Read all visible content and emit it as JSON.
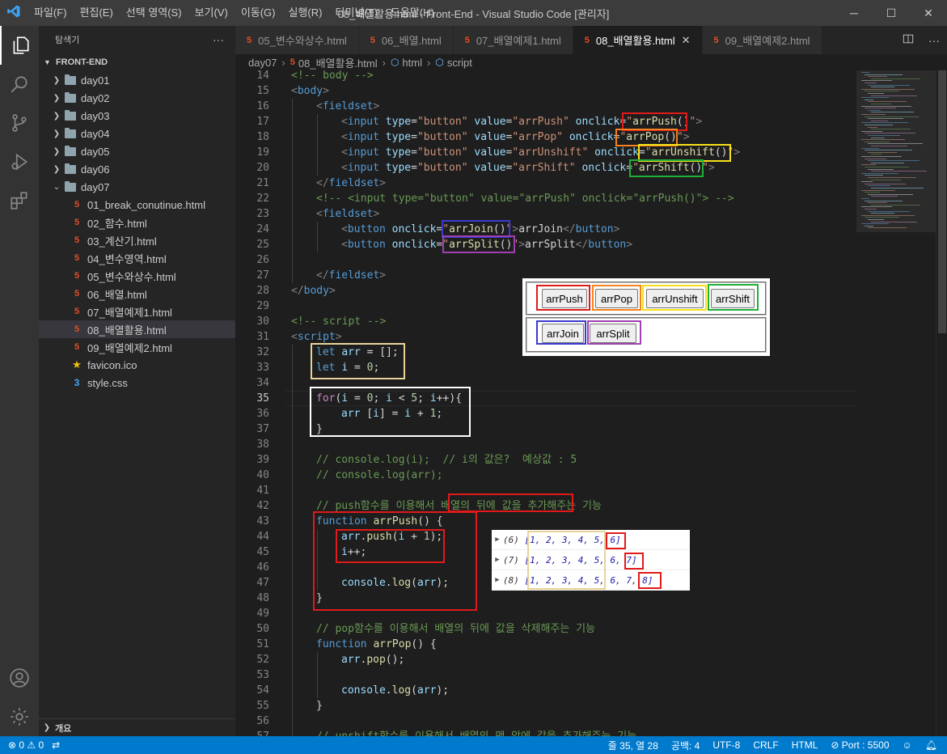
{
  "window": {
    "title": "08_배열활용.html - Front-End - Visual Studio Code [관리자]",
    "menu": [
      "파일(F)",
      "편집(E)",
      "선택 영역(S)",
      "보기(V)",
      "이동(G)",
      "실행(R)",
      "터미널(T)",
      "도움말(H)"
    ],
    "controls": [
      "─",
      "☐",
      "✕"
    ]
  },
  "activity_bar": {
    "items": [
      "explorer-icon",
      "search-icon",
      "source-control-icon",
      "run-debug-icon",
      "extensions-icon"
    ],
    "bottom": [
      "account-icon",
      "settings-gear-icon"
    ]
  },
  "sidebar": {
    "header": "탐색기",
    "more": "···",
    "section": "FRONT-END",
    "folders": [
      {
        "name": "day01",
        "open": false
      },
      {
        "name": "day02",
        "open": false
      },
      {
        "name": "day03",
        "open": false
      },
      {
        "name": "day04",
        "open": false
      },
      {
        "name": "day05",
        "open": false
      },
      {
        "name": "day06",
        "open": false
      },
      {
        "name": "day07",
        "open": true
      }
    ],
    "files": [
      {
        "name": "01_break_conutinue.html",
        "type": "html"
      },
      {
        "name": "02_함수.html",
        "type": "html"
      },
      {
        "name": "03_계산기.html",
        "type": "html"
      },
      {
        "name": "04_변수영역.html",
        "type": "html"
      },
      {
        "name": "05_변수와상수.html",
        "type": "html"
      },
      {
        "name": "06_배열.html",
        "type": "html"
      },
      {
        "name": "07_배열예제1.html",
        "type": "html"
      },
      {
        "name": "08_배열활용.html",
        "type": "html",
        "selected": true
      },
      {
        "name": "09_배열예제2.html",
        "type": "html"
      },
      {
        "name": "favicon.ico",
        "type": "ico"
      },
      {
        "name": "style.css",
        "type": "css"
      }
    ],
    "outline": "개요"
  },
  "tabs": [
    {
      "label": "05_변수와상수.html",
      "active": false
    },
    {
      "label": "06_배열.html",
      "active": false
    },
    {
      "label": "07_배열예제1.html",
      "active": false
    },
    {
      "label": "08_배열활용.html",
      "active": true,
      "close": "✕"
    },
    {
      "label": "09_배열예제2.html",
      "active": false
    }
  ],
  "tab_actions": [
    "split-editor-icon",
    "more-actions-icon"
  ],
  "breadcrumb": [
    "day07",
    "08_배열활용.html",
    "html",
    "script"
  ],
  "editor": {
    "current_line": 35,
    "lines": [
      {
        "n": 14,
        "ind": 0,
        "tokens": [
          [
            "c",
            "<!-- body -->"
          ]
        ]
      },
      {
        "n": 15,
        "ind": 0,
        "tokens": [
          [
            "p",
            "<"
          ],
          [
            "t",
            "body"
          ],
          [
            "p",
            ">"
          ]
        ]
      },
      {
        "n": 16,
        "ind": 1,
        "tokens": [
          [
            "p",
            "<"
          ],
          [
            "t",
            "fieldset"
          ],
          [
            "p",
            ">"
          ]
        ]
      },
      {
        "n": 17,
        "ind": 2,
        "tokens": [
          [
            "p",
            "<"
          ],
          [
            "t",
            "input"
          ],
          [
            "w",
            " "
          ],
          [
            "a",
            "type"
          ],
          [
            "w",
            "="
          ],
          [
            "s",
            "\"button\""
          ],
          [
            "w",
            " "
          ],
          [
            "a",
            "value"
          ],
          [
            "w",
            "="
          ],
          [
            "s",
            "\"arrPush\""
          ],
          [
            "w",
            " "
          ],
          [
            "a",
            "onclick"
          ],
          [
            "w",
            "="
          ],
          [
            "s",
            "\""
          ],
          [
            "f",
            "arrPush"
          ],
          [
            "w",
            "()"
          ],
          [
            "s",
            "\""
          ],
          [
            "p",
            ">"
          ]
        ]
      },
      {
        "n": 18,
        "ind": 2,
        "tokens": [
          [
            "p",
            "<"
          ],
          [
            "t",
            "input"
          ],
          [
            "w",
            " "
          ],
          [
            "a",
            "type"
          ],
          [
            "w",
            "="
          ],
          [
            "s",
            "\"button\""
          ],
          [
            "w",
            " "
          ],
          [
            "a",
            "value"
          ],
          [
            "w",
            "="
          ],
          [
            "s",
            "\"arrPop\""
          ],
          [
            "w",
            " "
          ],
          [
            "a",
            "onclick"
          ],
          [
            "w",
            "="
          ],
          [
            "s",
            "\""
          ],
          [
            "f",
            "arrPop"
          ],
          [
            "w",
            "()"
          ],
          [
            "s",
            "\""
          ],
          [
            "p",
            ">"
          ]
        ]
      },
      {
        "n": 19,
        "ind": 2,
        "tokens": [
          [
            "p",
            "<"
          ],
          [
            "t",
            "input"
          ],
          [
            "w",
            " "
          ],
          [
            "a",
            "type"
          ],
          [
            "w",
            "="
          ],
          [
            "s",
            "\"button\""
          ],
          [
            "w",
            " "
          ],
          [
            "a",
            "value"
          ],
          [
            "w",
            "="
          ],
          [
            "s",
            "\"arrUnshift\""
          ],
          [
            "w",
            " "
          ],
          [
            "a",
            "onclick"
          ],
          [
            "w",
            "="
          ],
          [
            "s",
            "\""
          ],
          [
            "f",
            "arrUnshift"
          ],
          [
            "w",
            "()"
          ],
          [
            "s",
            "\""
          ],
          [
            "p",
            ">"
          ]
        ]
      },
      {
        "n": 20,
        "ind": 2,
        "tokens": [
          [
            "p",
            "<"
          ],
          [
            "t",
            "input"
          ],
          [
            "w",
            " "
          ],
          [
            "a",
            "type"
          ],
          [
            "w",
            "="
          ],
          [
            "s",
            "\"button\""
          ],
          [
            "w",
            " "
          ],
          [
            "a",
            "value"
          ],
          [
            "w",
            "="
          ],
          [
            "s",
            "\"arrShift\""
          ],
          [
            "w",
            " "
          ],
          [
            "a",
            "onclick"
          ],
          [
            "w",
            "="
          ],
          [
            "s",
            "\""
          ],
          [
            "f",
            "arrShift"
          ],
          [
            "w",
            "()"
          ],
          [
            "s",
            "\""
          ],
          [
            "p",
            ">"
          ]
        ]
      },
      {
        "n": 21,
        "ind": 1,
        "tokens": [
          [
            "p",
            "</"
          ],
          [
            "t",
            "fieldset"
          ],
          [
            "p",
            ">"
          ]
        ]
      },
      {
        "n": 22,
        "ind": 1,
        "tokens": [
          [
            "c",
            "<!-- <input type=\"button\" value=\"arrPush\" onclick=\"arrPush()\"> -->"
          ]
        ]
      },
      {
        "n": 23,
        "ind": 1,
        "tokens": [
          [
            "p",
            "<"
          ],
          [
            "t",
            "fieldset"
          ],
          [
            "p",
            ">"
          ]
        ]
      },
      {
        "n": 24,
        "ind": 2,
        "tokens": [
          [
            "p",
            "<"
          ],
          [
            "t",
            "button"
          ],
          [
            "w",
            " "
          ],
          [
            "a",
            "onclick"
          ],
          [
            "w",
            "="
          ],
          [
            "s",
            "\""
          ],
          [
            "f",
            "arrJoin"
          ],
          [
            "w",
            "()"
          ],
          [
            "s",
            "\""
          ],
          [
            "p",
            ">"
          ],
          [
            "w",
            "arrJoin"
          ],
          [
            "p",
            "</"
          ],
          [
            "t",
            "button"
          ],
          [
            "p",
            ">"
          ]
        ]
      },
      {
        "n": 25,
        "ind": 2,
        "tokens": [
          [
            "p",
            "<"
          ],
          [
            "t",
            "button"
          ],
          [
            "w",
            " "
          ],
          [
            "a",
            "onclick"
          ],
          [
            "w",
            "="
          ],
          [
            "s",
            "\""
          ],
          [
            "f",
            "arrSplit"
          ],
          [
            "w",
            "()"
          ],
          [
            "s",
            "\""
          ],
          [
            "p",
            ">"
          ],
          [
            "w",
            "arrSplit"
          ],
          [
            "p",
            "</"
          ],
          [
            "t",
            "button"
          ],
          [
            "p",
            ">"
          ]
        ]
      },
      {
        "n": 26,
        "ind": 0,
        "tokens": []
      },
      {
        "n": 27,
        "ind": 1,
        "tokens": [
          [
            "p",
            "</"
          ],
          [
            "t",
            "fieldset"
          ],
          [
            "p",
            ">"
          ]
        ]
      },
      {
        "n": 28,
        "ind": 0,
        "tokens": [
          [
            "p",
            "</"
          ],
          [
            "t",
            "body"
          ],
          [
            "p",
            ">"
          ]
        ]
      },
      {
        "n": 29,
        "ind": 0,
        "tokens": []
      },
      {
        "n": 30,
        "ind": 0,
        "tokens": [
          [
            "c",
            "<!-- script -->"
          ]
        ]
      },
      {
        "n": 31,
        "ind": 0,
        "tokens": [
          [
            "p",
            "<"
          ],
          [
            "t",
            "script"
          ],
          [
            "p",
            ">"
          ]
        ]
      },
      {
        "n": 32,
        "ind": 1,
        "tokens": [
          [
            "st",
            "let"
          ],
          [
            "w",
            " "
          ],
          [
            "a",
            "arr"
          ],
          [
            "w",
            " = [];"
          ]
        ]
      },
      {
        "n": 33,
        "ind": 1,
        "tokens": [
          [
            "st",
            "let"
          ],
          [
            "w",
            " "
          ],
          [
            "a",
            "i"
          ],
          [
            "w",
            " = "
          ],
          [
            "n",
            "0"
          ],
          [
            "w",
            ";"
          ]
        ]
      },
      {
        "n": 34,
        "ind": 0,
        "tokens": []
      },
      {
        "n": 35,
        "ind": 1,
        "tokens": [
          [
            "k",
            "for"
          ],
          [
            "w",
            "("
          ],
          [
            "a",
            "i"
          ],
          [
            "w",
            " = "
          ],
          [
            "n",
            "0"
          ],
          [
            "w",
            "; "
          ],
          [
            "a",
            "i"
          ],
          [
            "w",
            " < "
          ],
          [
            "n",
            "5"
          ],
          [
            "w",
            "; "
          ],
          [
            "a",
            "i"
          ],
          [
            "w",
            "++){"
          ]
        ]
      },
      {
        "n": 36,
        "ind": 2,
        "tokens": [
          [
            "a",
            "arr"
          ],
          [
            "w",
            " ["
          ],
          [
            "a",
            "i"
          ],
          [
            "w",
            "] = "
          ],
          [
            "a",
            "i"
          ],
          [
            "w",
            " + "
          ],
          [
            "n",
            "1"
          ],
          [
            "w",
            ";"
          ]
        ]
      },
      {
        "n": 37,
        "ind": 1,
        "tokens": [
          [
            "w",
            "}"
          ]
        ]
      },
      {
        "n": 38,
        "ind": 0,
        "tokens": []
      },
      {
        "n": 39,
        "ind": 1,
        "tokens": [
          [
            "c",
            "// console.log(i);  // i의 값은?  예상값 : 5"
          ]
        ]
      },
      {
        "n": 40,
        "ind": 1,
        "tokens": [
          [
            "c",
            "// console.log(arr);"
          ]
        ]
      },
      {
        "n": 41,
        "ind": 0,
        "tokens": []
      },
      {
        "n": 42,
        "ind": 1,
        "tokens": [
          [
            "c",
            "// push함수를 이용해서 배열의 뒤에 값을 추가해주는 기능"
          ]
        ]
      },
      {
        "n": 43,
        "ind": 1,
        "tokens": [
          [
            "st",
            "function"
          ],
          [
            "w",
            " "
          ],
          [
            "f",
            "arrPush"
          ],
          [
            "w",
            "() {"
          ]
        ]
      },
      {
        "n": 44,
        "ind": 2,
        "tokens": [
          [
            "a",
            "arr"
          ],
          [
            "w",
            "."
          ],
          [
            "f",
            "push"
          ],
          [
            "w",
            "("
          ],
          [
            "a",
            "i"
          ],
          [
            "w",
            " + "
          ],
          [
            "n",
            "1"
          ],
          [
            "w",
            ");"
          ]
        ]
      },
      {
        "n": 45,
        "ind": 2,
        "tokens": [
          [
            "a",
            "i"
          ],
          [
            "w",
            "++;"
          ]
        ]
      },
      {
        "n": 46,
        "ind": 0,
        "tokens": []
      },
      {
        "n": 47,
        "ind": 2,
        "tokens": [
          [
            "a",
            "console"
          ],
          [
            "w",
            "."
          ],
          [
            "f",
            "log"
          ],
          [
            "w",
            "("
          ],
          [
            "a",
            "arr"
          ],
          [
            "w",
            ");"
          ]
        ]
      },
      {
        "n": 48,
        "ind": 1,
        "tokens": [
          [
            "w",
            "}"
          ]
        ]
      },
      {
        "n": 49,
        "ind": 0,
        "tokens": []
      },
      {
        "n": 50,
        "ind": 1,
        "tokens": [
          [
            "c",
            "// pop함수를 이용해서 배열의 뒤에 값을 삭제해주는 기능"
          ]
        ]
      },
      {
        "n": 51,
        "ind": 1,
        "tokens": [
          [
            "st",
            "function"
          ],
          [
            "w",
            " "
          ],
          [
            "f",
            "arrPop"
          ],
          [
            "w",
            "() {"
          ]
        ]
      },
      {
        "n": 52,
        "ind": 2,
        "tokens": [
          [
            "a",
            "arr"
          ],
          [
            "w",
            "."
          ],
          [
            "f",
            "pop"
          ],
          [
            "w",
            "();"
          ]
        ]
      },
      {
        "n": 53,
        "ind": 0,
        "tokens": []
      },
      {
        "n": 54,
        "ind": 2,
        "tokens": [
          [
            "a",
            "console"
          ],
          [
            "w",
            "."
          ],
          [
            "f",
            "log"
          ],
          [
            "w",
            "("
          ],
          [
            "a",
            "arr"
          ],
          [
            "w",
            ");"
          ]
        ]
      },
      {
        "n": 55,
        "ind": 1,
        "tokens": [
          [
            "w",
            "}"
          ]
        ]
      },
      {
        "n": 56,
        "ind": 0,
        "tokens": []
      },
      {
        "n": 57,
        "ind": 1,
        "tokens": [
          [
            "c",
            "// unshift함수를 이용해서 배열의 맨 앞에 값을 추가해주는 기능"
          ]
        ]
      }
    ]
  },
  "highlights": {
    "red": "#e01a1a",
    "orange": "#f5821f",
    "yellow": "#f7e01b",
    "green": "#1fb03a",
    "blue": "#3a3ad0",
    "purple": "#a040b0",
    "tan": "#e8d39a",
    "white": "#ffffff"
  },
  "preview": {
    "row1": [
      "arrPush",
      "arrPop",
      "arrUnshift",
      "arrShift"
    ],
    "row2": [
      "arrJoin",
      "arrSplit"
    ]
  },
  "console": {
    "rows": [
      {
        "count": "(6)",
        "base": "[1, 2, 3, 4, 5,",
        "added": " 6]"
      },
      {
        "count": "(7)",
        "base": "[1, 2, 3, 4, 5,",
        "added": " 6, 7]"
      },
      {
        "count": "(8)",
        "base": "[1, 2, 3, 4, 5,",
        "added": " 6, 7, 8]"
      }
    ]
  },
  "statusbar": {
    "errors": "⊗ 0",
    "warnings": "⚠ 0",
    "position": "줄 35, 열 28",
    "spaces": "공백: 4",
    "encoding": "UTF-8",
    "eol": "CRLF",
    "language": "HTML",
    "port": "Port : 5500"
  }
}
